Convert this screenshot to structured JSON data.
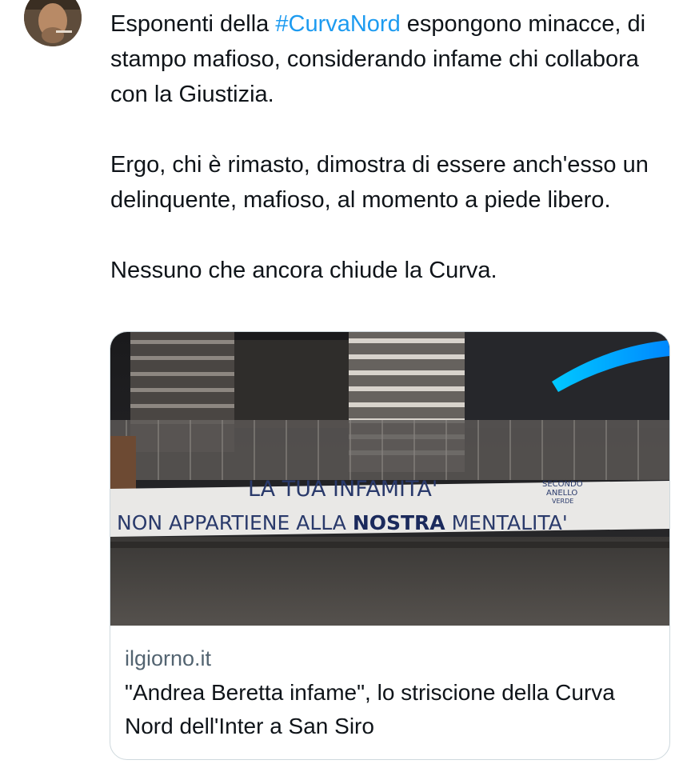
{
  "tweet": {
    "text_before_hashtag": "Esponenti della ",
    "hashtag": "#CurvaNord",
    "text_after_hashtag": " espongono minacce, di stampo mafioso, considerando infame chi collabora con la Giustizia.",
    "paragraph2": "Ergo, chi è rimasto, dimostra di essere anch'esso un delinquente, mafioso, al momento a piede libero.",
    "paragraph3": "Nessuno che ancora chiude la Curva."
  },
  "card": {
    "banner_line1": "LA TUA INFAMITA'",
    "banner_line2_before": "NON APPARTIENE ALLA ",
    "banner_line2_highlight": "NOSTRA",
    "banner_line2_after": " MENTALITA'",
    "banner_signature": [
      "SECONDO",
      "ANELLO",
      "VERDE"
    ],
    "domain": "ilgiorno.it",
    "title": "\"Andrea Beretta infame\", lo striscione della Curva Nord dell'Inter a San Siro"
  },
  "colors": {
    "link": "#1d9bf0",
    "secondary_text": "#536471",
    "border": "#cfd9de"
  }
}
